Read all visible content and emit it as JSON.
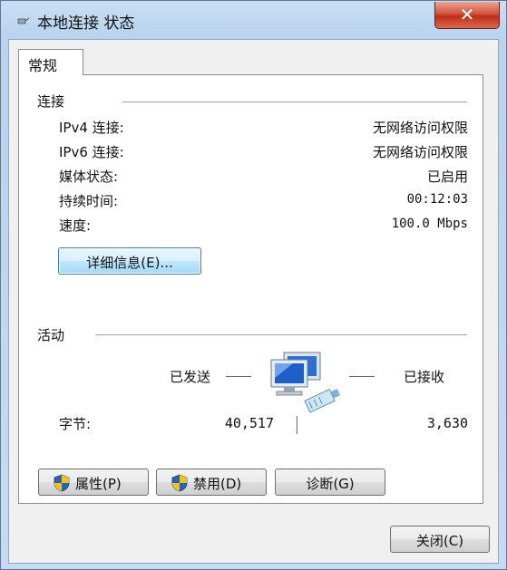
{
  "window": {
    "title": "本地连接 状态",
    "close_glyph": "✕"
  },
  "tabs": [
    {
      "label": "常规"
    }
  ],
  "connection": {
    "heading": "连接",
    "rows": [
      {
        "label": "IPv4 连接:",
        "value": "无网络访问权限"
      },
      {
        "label": "IPv6 连接:",
        "value": "无网络访问权限"
      },
      {
        "label": "媒体状态:",
        "value": "已启用"
      },
      {
        "label": "持续时间:",
        "value": "00:12:03"
      },
      {
        "label": "速度:",
        "value": "100.0 Mbps"
      }
    ],
    "details_button": "详细信息(E)..."
  },
  "activity": {
    "heading": "活动",
    "sent_label": "已发送",
    "received_label": "已接收",
    "bytes_label": "字节:",
    "bytes_sent": "40,517",
    "bytes_received": "3,630"
  },
  "buttons": {
    "properties": "属性(P)",
    "disable": "禁用(D)",
    "diagnose": "诊断(G)",
    "close": "关闭(C)"
  },
  "icons": {
    "title": "network-connection-icon",
    "activity": "network-computers-icon",
    "shield": "uac-shield-icon"
  },
  "colors": {
    "title_bar": "#b9d3ee",
    "close_button": "#c7361d",
    "focus_button": "#bee6fd"
  }
}
